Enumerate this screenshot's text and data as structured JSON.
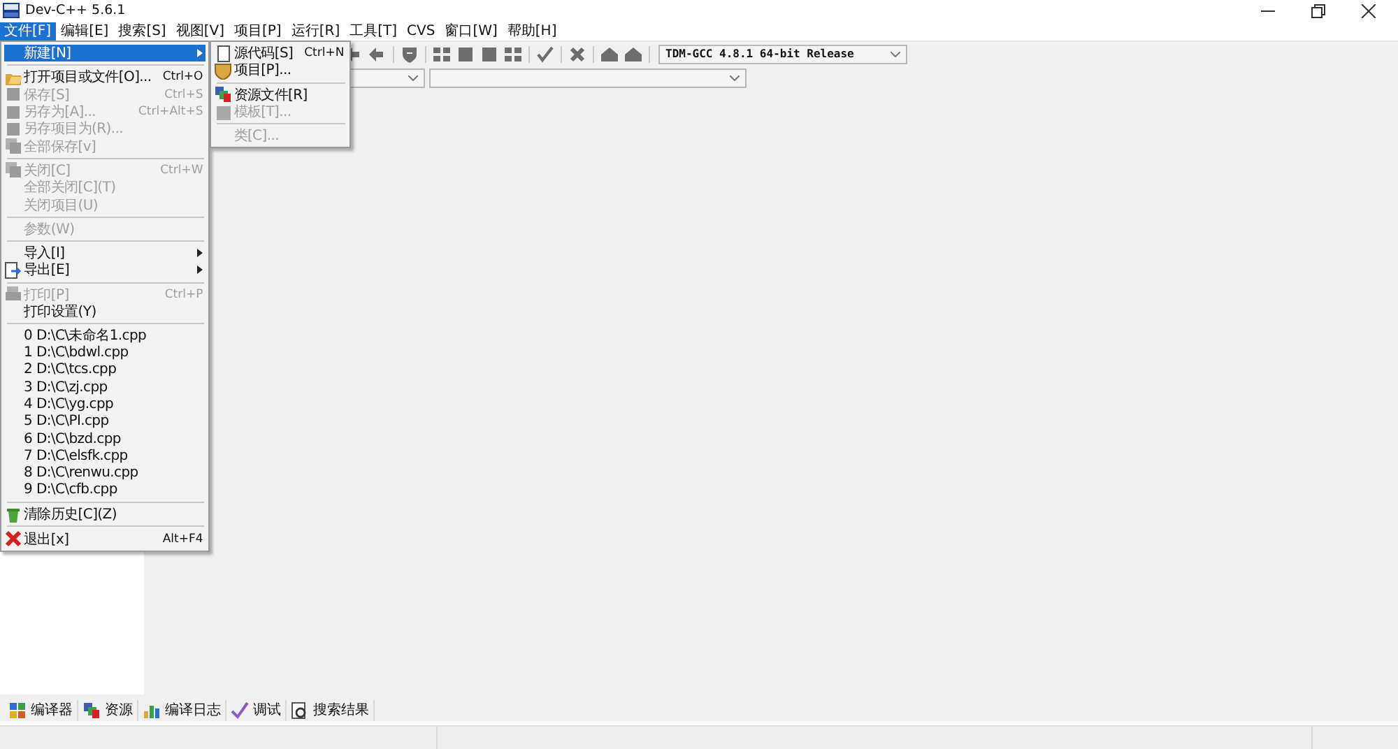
{
  "window": {
    "title": "Dev-C++ 5.6.1"
  },
  "menubar": [
    {
      "label": "文件[F]",
      "selected": true
    },
    {
      "label": "编辑[E]",
      "selected": false
    },
    {
      "label": "搜索[S]",
      "selected": false
    },
    {
      "label": "视图[V]",
      "selected": false
    },
    {
      "label": "项目[P]",
      "selected": false
    },
    {
      "label": "运行[R]",
      "selected": false
    },
    {
      "label": "工具[T]",
      "selected": false
    },
    {
      "label": "CVS",
      "selected": false
    },
    {
      "label": "窗口[W]",
      "selected": false
    },
    {
      "label": "帮助[H]",
      "selected": false
    }
  ],
  "toolbar": {
    "compiler": "TDM-GCC 4.8.1 64-bit Release"
  },
  "file_menu": [
    {
      "kind": "item",
      "label": "新建[N]",
      "selected": true,
      "disabled": false,
      "submenu": true
    },
    {
      "kind": "separator"
    },
    {
      "kind": "item",
      "label": "打开项目或文件[O]...",
      "shortcut": "Ctrl+O",
      "selected": false,
      "disabled": false,
      "submenu": false
    },
    {
      "kind": "item",
      "label": "保存[S]",
      "shortcut": "Ctrl+S",
      "selected": false,
      "disabled": true,
      "submenu": false
    },
    {
      "kind": "item",
      "label": "另存为[A]...",
      "shortcut": "Ctrl+Alt+S",
      "selected": false,
      "disabled": true,
      "submenu": false
    },
    {
      "kind": "item",
      "label": "另存项目为(R)...",
      "selected": false,
      "disabled": true,
      "submenu": false
    },
    {
      "kind": "item",
      "label": "全部保存[v]",
      "selected": false,
      "disabled": true,
      "submenu": false
    },
    {
      "kind": "separator"
    },
    {
      "kind": "item",
      "label": "关闭[C]",
      "shortcut": "Ctrl+W",
      "selected": false,
      "disabled": true,
      "submenu": false
    },
    {
      "kind": "item",
      "label": "全部关闭[C](T)",
      "selected": false,
      "disabled": true,
      "submenu": false
    },
    {
      "kind": "item",
      "label": "关闭项目(U)",
      "selected": false,
      "disabled": true,
      "submenu": false
    },
    {
      "kind": "separator"
    },
    {
      "kind": "item",
      "label": "参数(W)",
      "selected": false,
      "disabled": true,
      "submenu": false
    },
    {
      "kind": "separator"
    },
    {
      "kind": "item",
      "label": "导入[I]",
      "selected": false,
      "disabled": false,
      "submenu": true
    },
    {
      "kind": "item",
      "label": "导出[E]",
      "selected": false,
      "disabled": false,
      "submenu": true
    },
    {
      "kind": "separator"
    },
    {
      "kind": "item",
      "label": "打印[P]",
      "shortcut": "Ctrl+P",
      "selected": false,
      "disabled": true,
      "submenu": false
    },
    {
      "kind": "item",
      "label": "打印设置(Y)",
      "selected": false,
      "disabled": false,
      "submenu": false
    },
    {
      "kind": "separator"
    },
    {
      "kind": "item",
      "label": "0 D:\\C\\未命名1.cpp",
      "selected": false,
      "disabled": false,
      "submenu": false
    },
    {
      "kind": "item",
      "label": "1 D:\\C\\bdwl.cpp",
      "selected": false,
      "disabled": false,
      "submenu": false
    },
    {
      "kind": "item",
      "label": "2 D:\\C\\tcs.cpp",
      "selected": false,
      "disabled": false,
      "submenu": false
    },
    {
      "kind": "item",
      "label": "3 D:\\C\\zj.cpp",
      "selected": false,
      "disabled": false,
      "submenu": false
    },
    {
      "kind": "item",
      "label": "4 D:\\C\\yg.cpp",
      "selected": false,
      "disabled": false,
      "submenu": false
    },
    {
      "kind": "item",
      "label": "5 D:\\C\\PI.cpp",
      "selected": false,
      "disabled": false,
      "submenu": false
    },
    {
      "kind": "item",
      "label": "6 D:\\C\\bzd.cpp",
      "selected": false,
      "disabled": false,
      "submenu": false
    },
    {
      "kind": "item",
      "label": "7 D:\\C\\elsfk.cpp",
      "selected": false,
      "disabled": false,
      "submenu": false
    },
    {
      "kind": "item",
      "label": "8 D:\\C\\renwu.cpp",
      "selected": false,
      "disabled": false,
      "submenu": false
    },
    {
      "kind": "item",
      "label": "9 D:\\C\\cfb.cpp",
      "selected": false,
      "disabled": false,
      "submenu": false
    },
    {
      "kind": "separator"
    },
    {
      "kind": "item",
      "label": "清除历史[C](Z)",
      "selected": false,
      "disabled": false,
      "submenu": false
    },
    {
      "kind": "separator"
    },
    {
      "kind": "item",
      "label": "退出[x]",
      "shortcut": "Alt+F4",
      "selected": false,
      "disabled": false,
      "submenu": false
    }
  ],
  "new_submenu": [
    {
      "kind": "item",
      "label": "源代码[S]",
      "shortcut": "Ctrl+N",
      "disabled": false
    },
    {
      "kind": "item",
      "label": "项目[P]...",
      "disabled": false
    },
    {
      "kind": "separator"
    },
    {
      "kind": "item",
      "label": "资源文件[R]",
      "disabled": false
    },
    {
      "kind": "item",
      "label": "模板[T]...",
      "disabled": true
    },
    {
      "kind": "separator"
    },
    {
      "kind": "item",
      "label": "类[C]...",
      "disabled": true
    }
  ],
  "bottom_tabs": [
    {
      "label": "编译器"
    },
    {
      "label": "资源"
    },
    {
      "label": "编译日志"
    },
    {
      "label": "调试"
    },
    {
      "label": "搜索结果"
    }
  ]
}
